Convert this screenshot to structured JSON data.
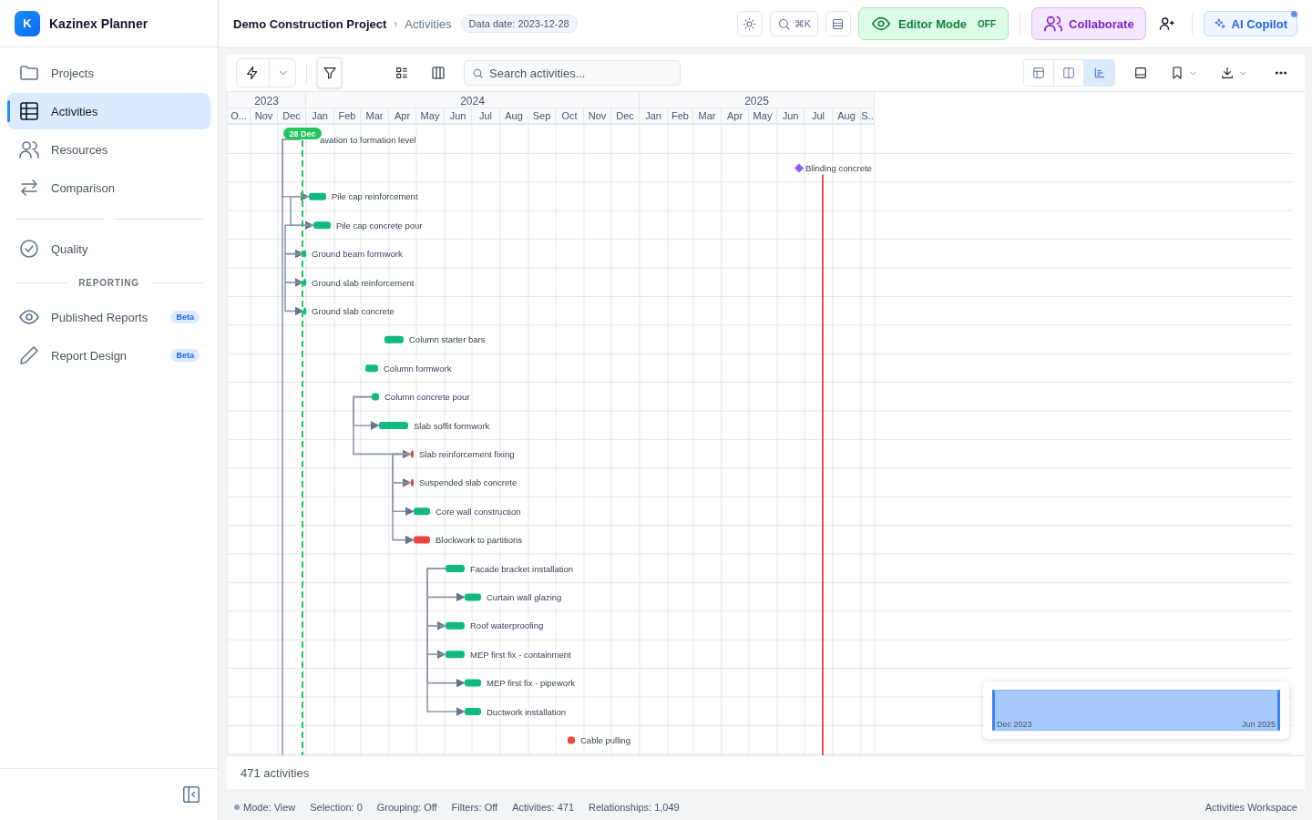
{
  "app": {
    "name": "Kazinex Planner",
    "logo_letter": "K"
  },
  "sidebar": {
    "nav": [
      {
        "label": "Projects",
        "selected": false
      },
      {
        "label": "Activities",
        "selected": true
      },
      {
        "label": "Resources",
        "selected": false
      },
      {
        "label": "Comparison",
        "selected": false
      }
    ],
    "quality": [
      {
        "label": "Quality",
        "selected": false
      }
    ],
    "reporting": {
      "title": "REPORTING",
      "items": [
        {
          "label": "Published Reports",
          "badge": "Beta",
          "selected": false
        },
        {
          "label": "Report Design",
          "badge": "Beta",
          "selected": false
        }
      ]
    }
  },
  "header": {
    "project": "Demo Construction Project",
    "separator": "›",
    "page": "Activities",
    "data_date": "Data date: 2023-12-28",
    "search_shortcut": "⌘K",
    "editor_mode": {
      "label": "Editor Mode",
      "state": "OFF"
    },
    "collaborate": "Collaborate",
    "ai_copilot": {
      "label": "AI Copilot",
      "notification": true
    }
  },
  "toolbar": {
    "search_placeholder": "Search activities...",
    "filter": {
      "selected": true
    },
    "views": [
      {
        "selected": false
      },
      {
        "selected": false
      },
      {
        "selected": true
      }
    ]
  },
  "gantt": {
    "timeline": {
      "years": [
        "2023",
        "2024",
        "2025"
      ],
      "months": [
        "O...",
        "Nov",
        "Dec",
        "Jan",
        "Feb",
        "Mar",
        "Apr",
        "May",
        "Jun",
        "Jul",
        "Aug",
        "Sep",
        "Oct",
        "Nov",
        "Dec",
        "Jan",
        "Feb",
        "Mar",
        "Apr",
        "May",
        "Jun",
        "Jul",
        "Aug",
        "S.."
      ]
    },
    "data_date": {
      "label": "28 Dec"
    },
    "activities": [
      {
        "name": "avation to formation level",
        "kind": "none"
      },
      {
        "name": "Blinding concrete",
        "kind": "milestone",
        "color": "#8b5cf6"
      },
      {
        "name": "Pile cap reinforcement",
        "kind": "bar",
        "color": "#10b981"
      },
      {
        "name": "Pile cap concrete pour",
        "kind": "bar",
        "color": "#10b981"
      },
      {
        "name": "Ground beam formwork",
        "kind": "bar",
        "color": "#10b981"
      },
      {
        "name": "Ground slab reinforcement",
        "kind": "bar",
        "color": "#10b981"
      },
      {
        "name": "Ground slab concrete",
        "kind": "bar",
        "color": "#10b981"
      },
      {
        "name": "Column starter bars",
        "kind": "bar",
        "color": "#10b981"
      },
      {
        "name": "Column formwork",
        "kind": "bar",
        "color": "#10b981"
      },
      {
        "name": "Column concrete pour",
        "kind": "bar",
        "color": "#10b981"
      },
      {
        "name": "Slab soffit formwork",
        "kind": "bar",
        "color": "#10b981"
      },
      {
        "name": "Slab reinforcement fixing",
        "kind": "bar",
        "color": "#ef4444"
      },
      {
        "name": "Suspended slab concrete",
        "kind": "bar",
        "color": "#ef4444"
      },
      {
        "name": "Core wall construction",
        "kind": "bar",
        "color": "#10b981"
      },
      {
        "name": "Blockwork to partitions",
        "kind": "bar",
        "color": "#ef4444"
      },
      {
        "name": "Facade bracket installation",
        "kind": "bar",
        "color": "#10b981"
      },
      {
        "name": "Curtain wall glazing",
        "kind": "bar",
        "color": "#10b981"
      },
      {
        "name": "Roof waterproofing",
        "kind": "bar",
        "color": "#10b981"
      },
      {
        "name": "MEP first fix - containment",
        "kind": "bar",
        "color": "#10b981"
      },
      {
        "name": "MEP first fix - pipework",
        "kind": "bar",
        "color": "#10b981"
      },
      {
        "name": "Ductwork installation",
        "kind": "bar",
        "color": "#10b981"
      },
      {
        "name": "Cable pulling",
        "kind": "bar",
        "color": "#ef4444"
      }
    ],
    "minimap": {
      "from": "Dec 2023",
      "to": "Jun 2025"
    }
  },
  "footer": {
    "count": "471 activities"
  },
  "status_bar": {
    "items": [
      "Mode: View",
      "Selection: 0",
      "Grouping: Off",
      "Filters: Off",
      "Activities: 471",
      "Relationships: 1,049"
    ],
    "workspace": "Activities Workspace"
  }
}
